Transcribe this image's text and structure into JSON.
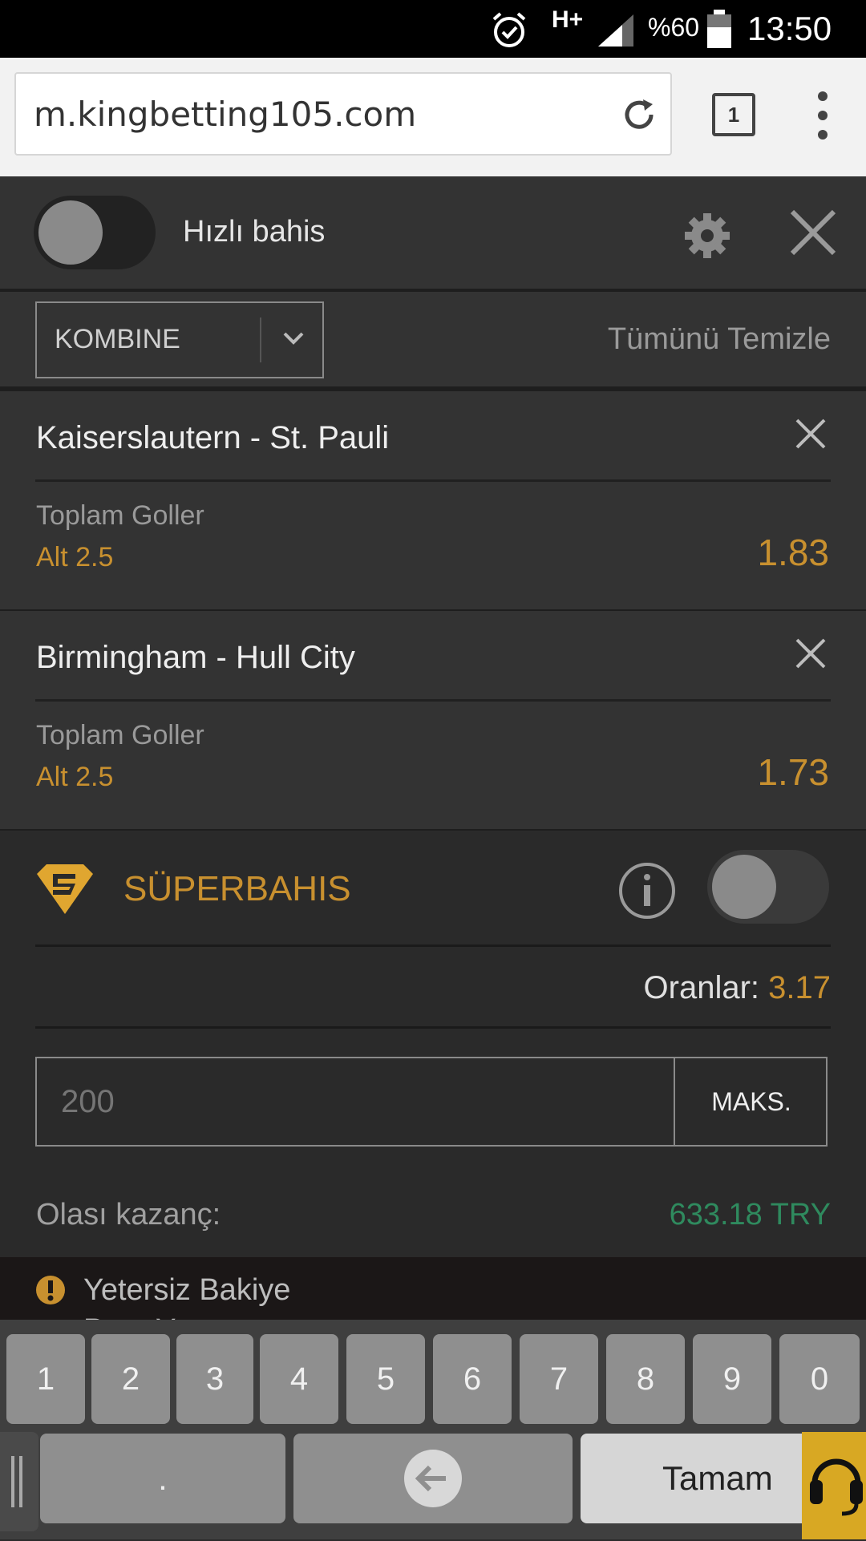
{
  "status_bar": {
    "network": "H+",
    "battery": "%60",
    "time": "13:50"
  },
  "browser": {
    "url": "m.kingbetting105.com",
    "tab_count": "1"
  },
  "betslip": {
    "quick_bet_label": "Hızlı bahis",
    "bet_type": "KOMBINE",
    "clear_all": "Tümünü Temizle",
    "selections": [
      {
        "match": "Kaiserslautern - St. Pauli",
        "market": "Toplam Goller",
        "pick": "Alt 2.5",
        "odd": "1.83"
      },
      {
        "match": "Birmingham - Hull City",
        "market": "Toplam Goller",
        "pick": "Alt 2.5",
        "odd": "1.73"
      }
    ],
    "superbahis_label": "SÜPERBAHIS",
    "odds_label": "Oranlar:",
    "odds_value": "3.17",
    "stake_placeholder": "200",
    "max_button": "MAKS.",
    "winnings_label": "Olası kazanç:",
    "winnings_value": "633.18 TRY",
    "alert_text": "Yetersiz Bakiye",
    "alert_subtext": "Para Yatır"
  },
  "keyboard": {
    "digits": [
      "1",
      "2",
      "3",
      "4",
      "5",
      "6",
      "7",
      "8",
      "9",
      "0"
    ],
    "dot": ".",
    "done": "Tamam"
  },
  "colors": {
    "accent": "#c8902f",
    "win_green": "#2f8a5e",
    "panel": "#333333"
  }
}
